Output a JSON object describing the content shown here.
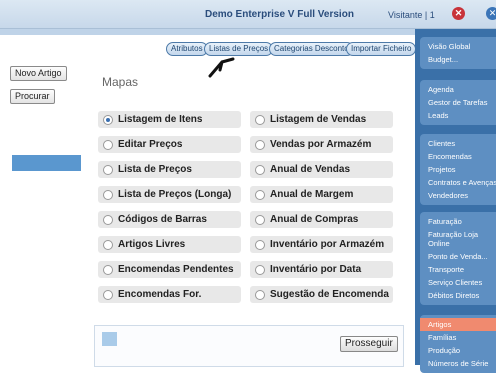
{
  "header": {
    "title": "Demo Enterprise V Full Version",
    "user": "Visitante | 1"
  },
  "left_buttons": {
    "new_item": "Novo Artigo",
    "search": "Procurar"
  },
  "tabs": [
    "Atributos",
    "Listas de Preços",
    "Categorias Desconto",
    "Importar Ficheiro"
  ],
  "section_title": "Mapas",
  "options_left": [
    "Listagem de Itens",
    "Editar Preços",
    "Lista de Preços",
    "Lista de Preços (Longa)",
    "Códigos de Barras",
    "Artigos Livres",
    "Encomendas Pendentes",
    "Encomendas For."
  ],
  "options_right": [
    "Listagem de Vendas",
    "Vendas por Armazém",
    "Anual de Vendas",
    "Anual de Margem",
    "Anual de Compras",
    "Inventário por Armazém",
    "Inventário por Data",
    "Sugestão de Encomenda"
  ],
  "selected_option": "Listagem de Itens",
  "continue_label": "Prosseguir",
  "sidebar": {
    "group1": [
      "Visão Global",
      "Budget..."
    ],
    "group2": [
      "Agenda",
      "Gestor de Tarefas",
      "Leads"
    ],
    "group3": [
      "Clientes",
      "Encomendas",
      "Projetos",
      "Contratos e Avenças",
      "Vendedores"
    ],
    "group4": [
      "Faturação",
      "Faturação Loja Online",
      "Ponto de Venda...",
      "Transporte",
      "Serviço Clientes",
      "Débitos Diretos"
    ],
    "group5": [
      "Artigos",
      "Famílias",
      "Produção",
      "Números de Série"
    ]
  },
  "icons": {
    "close": "close-icon",
    "extra": "circle-icon",
    "pen": "pen-mark-icon"
  },
  "colors": {
    "accent": "#3a70a8",
    "active": "#f08a6f",
    "header": "#c7d8ea"
  }
}
